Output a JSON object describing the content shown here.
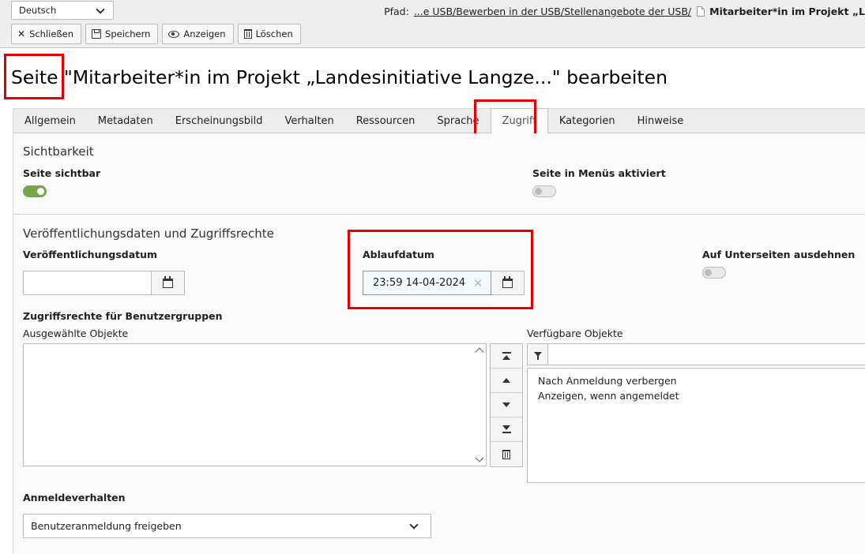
{
  "header": {
    "language": "Deutsch",
    "path_label": "Pfad:",
    "path_link": "...e USB/Bewerben in der USB/Stellenangebote der USB/",
    "path_title": "Mitarbeiter*in im Projekt „L"
  },
  "toolbar": {
    "close_label": "Schließen",
    "save_label": "Speichern",
    "view_label": "Anzeigen",
    "delete_label": "Löschen"
  },
  "page": {
    "title_prefix": "Seite",
    "title_rest": " \"Mitarbeiter*in im Projekt „Landesinitiative Langze...\" bearbeiten"
  },
  "tabs": [
    {
      "label": "Allgemein",
      "active": false
    },
    {
      "label": "Metadaten",
      "active": false
    },
    {
      "label": "Erscheinungsbild",
      "active": false
    },
    {
      "label": "Verhalten",
      "active": false
    },
    {
      "label": "Ressourcen",
      "active": false
    },
    {
      "label": "Sprache",
      "active": false
    },
    {
      "label": "Zugriff",
      "active": true
    },
    {
      "label": "Kategorien",
      "active": false
    },
    {
      "label": "Hinweise",
      "active": false
    }
  ],
  "visibility": {
    "title": "Sichtbarkeit",
    "page_visible_label": "Seite sichtbar",
    "page_visible_on": true,
    "menu_enabled_label": "Seite in Menüs aktiviert",
    "menu_enabled_on": false
  },
  "access": {
    "title": "Veröffentlichungsdaten und Zugriffsrechte",
    "publish_date_label": "Veröffentlichungsdatum",
    "publish_date_value": "",
    "expiry_date_label": "Ablaufdatum",
    "expiry_date_value": "23:59 14-04-2024",
    "extend_subpages_label": "Auf Unterseiten ausdehnen",
    "extend_subpages_on": false,
    "usergroups_label": "Zugriffsrechte für Benutzergruppen",
    "selected_label": "Ausgewählte Objekte",
    "available_label": "Verfügbare Objekte",
    "filter_value": "",
    "available_items": [
      "Nach Anmeldung verbergen",
      "Anzeigen, wenn angemeldet"
    ],
    "login_behaviour_label": "Anmeldeverhalten",
    "login_behaviour_value": "Benutzeranmeldung freigeben"
  },
  "colors": {
    "highlight_box": "#e00000",
    "toggle_on": "#79a548"
  }
}
